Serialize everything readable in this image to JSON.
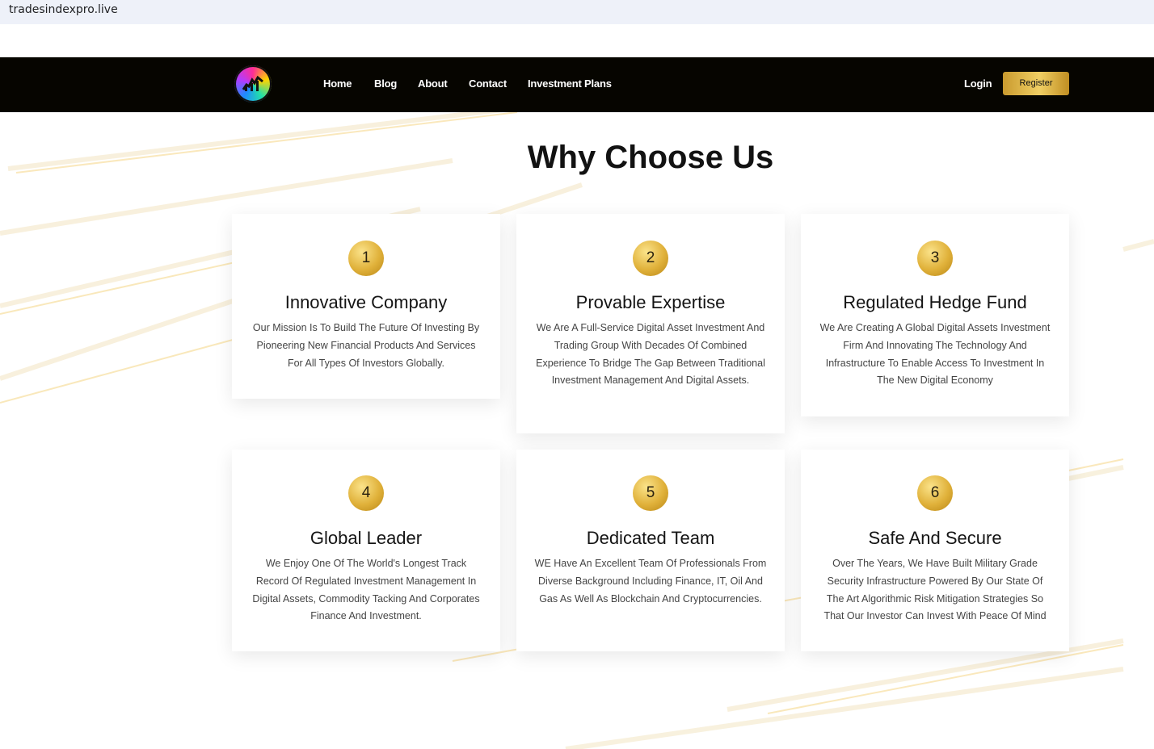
{
  "browser": {
    "url": "tradesindexpro.live"
  },
  "nav": {
    "links": [
      "Home",
      "Blog",
      "About",
      "Contact",
      "Investment Plans"
    ],
    "login": "Login",
    "register": "Register"
  },
  "section": {
    "title": "Why Choose Us",
    "cards": [
      {
        "number": "1",
        "title": "Innovative Company",
        "text": "Our Mission Is To Build The Future Of Investing By Pioneering New Financial Products And Services For All Types Of Investors Globally."
      },
      {
        "number": "2",
        "title": "Provable Expertise",
        "text": "We Are A Full-Service Digital Asset Investment And Trading Group With Decades Of Combined Experience To Bridge The Gap Between Traditional Investment Management And Digital Assets."
      },
      {
        "number": "3",
        "title": "Regulated Hedge Fund",
        "text": "We Are Creating A Global Digital Assets Investment Firm And Innovating The Technology And Infrastructure To Enable Access To Investment In The New Digital Economy"
      },
      {
        "number": "4",
        "title": "Global Leader",
        "text": "We Enjoy One Of The World's Longest Track Record Of Regulated Investment Management In Digital Assets, Commodity Tacking And Corporates Finance And Investment."
      },
      {
        "number": "5",
        "title": "Dedicated Team",
        "text": "WE Have An Excellent Team Of Professionals From Diverse Background Including Finance, IT, Oil And Gas As Well As Blockchain And Cryptocurrencies."
      },
      {
        "number": "6",
        "title": "Safe And Secure",
        "text": "Over The Years, We Have Built Military Grade Security Infrastructure Powered By Our State Of The Art Algorithmic Risk Mitigation Strategies So That Our Investor Can Invest With Peace Of Mind"
      }
    ]
  },
  "colors": {
    "navbar": "#060500",
    "gold": "#e0b13a",
    "accent_light": "#f0cf64"
  }
}
